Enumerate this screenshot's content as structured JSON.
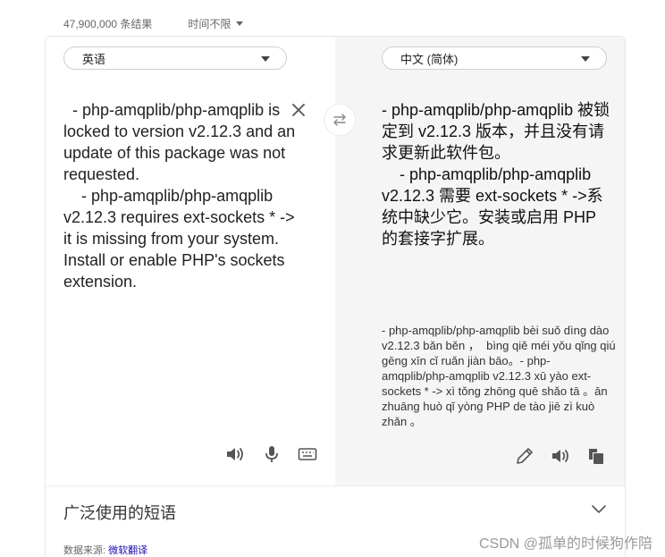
{
  "results_bar": {
    "count": "47,900,000 条结果",
    "time_filter": "时间不限"
  },
  "translator": {
    "source_lang": "英语",
    "target_lang": "中文 (简体)",
    "source_text": "  - php-amqplib/php-amqplib is locked to version v2.12.3 and an update of this package was not requested.\n    - php-amqplib/php-amqplib v2.12.3 requires ext-sockets * -> it is missing from your system. Install or enable PHP's sockets extension.",
    "target_text": "- php-amqplib/php-amqplib 被锁定到 v2.12.3 版本，并且没有请求更新此软件包。\n    - php-amqplib/php-amqplib v2.12.3 需要 ext-sockets * ->系统中缺少它。安装或启用 PHP 的套接字扩展。",
    "pinyin_text": "- php-amqplib/php-amqplib bèi suǒ dìng dào v2.12.3 bǎn běn ，  bìng qiě méi yǒu qǐng qiú gēng xīn cǐ ruǎn jiàn bāo。- php-amqplib/php-amqplib v2.12.3 xū yào ext-sockets * -> xì tǒng zhōng quē shǎo tā 。ān zhuāng huò qǐ yòng PHP de tào jiē zì kuò zhǎn 。"
  },
  "phrases": {
    "label": "广泛使用的短语"
  },
  "source_line": {
    "prefix": "数据来源: ",
    "link": "微软翻译"
  },
  "watermark": "CSDN @孤单的时候狗作陪"
}
